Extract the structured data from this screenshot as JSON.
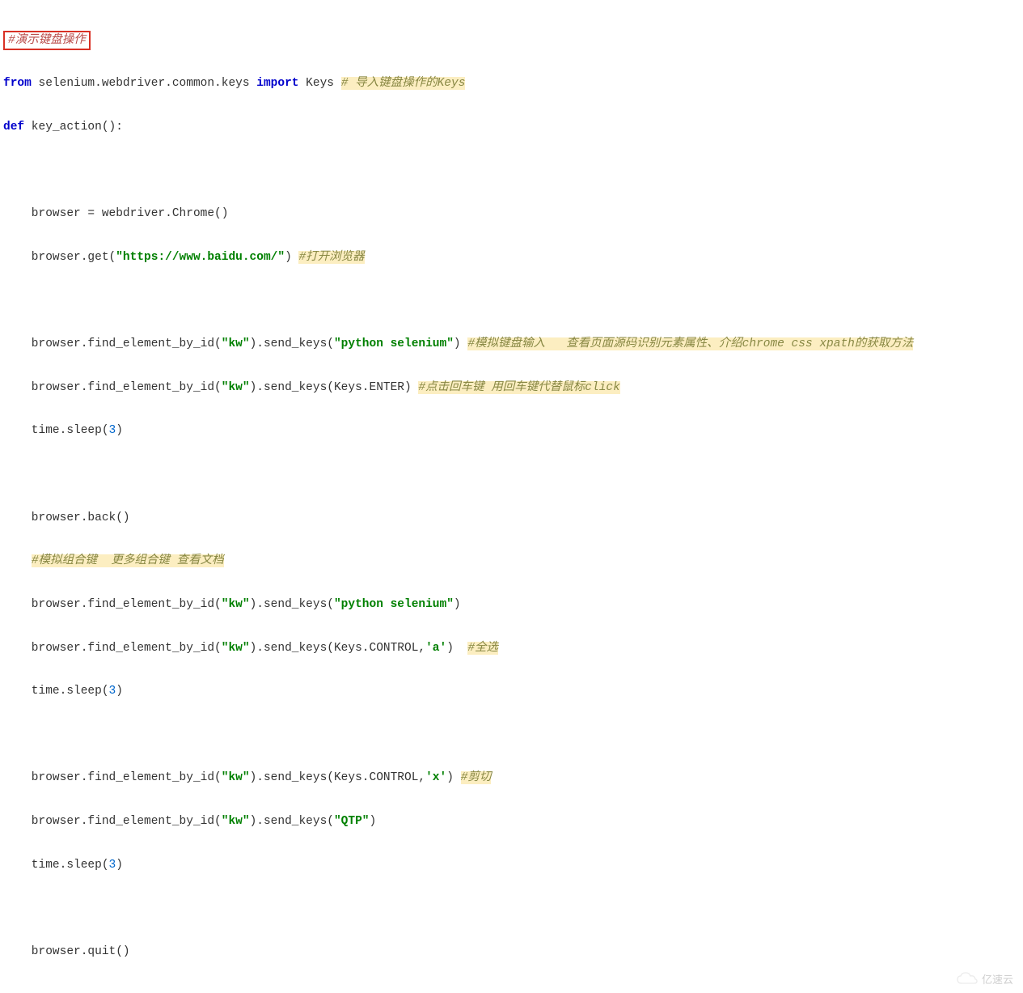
{
  "code": {
    "comment_title": "#演示键盘操作",
    "import_from": "from",
    "import_mod": " selenium.webdriver.common.keys ",
    "import_kw": "import",
    "import_name": " Keys ",
    "import_cmt": "# 导入键盘操作的Keys",
    "def_kw": "def",
    "def_name": " key_action():",
    "l_browser_assign": "    browser = webdriver.Chrome()",
    "l_get_pre": "    browser.get(",
    "l_get_url": "\"https://www.baidu.com/\"",
    "l_get_post": ") ",
    "l_get_cmt": "#打开浏览器",
    "l_send1_pre": "    browser.find_element_by_id(",
    "l_kw": "\"kw\"",
    "l_send1_mid": ").send_keys(",
    "l_send1_val": "\"python selenium\"",
    "l_send1_post": ") ",
    "l_send1_cmt": "#模拟键盘输入   查看页面源码识别元素属性、介绍chrome css xpath的获取方法",
    "l_send2_pre": "    browser.find_element_by_id(",
    "l_send2_mid": ").send_keys(Keys.ENTER) ",
    "l_send2_cmt": "#点击回车键 用回车键代替鼠标click",
    "l_sleep_pre": "    time.sleep(",
    "l_sleep_num": "3",
    "l_sleep_post": ")",
    "l_back": "    browser.back()",
    "l_combo_cmt": "#模拟组合键  更多组合键 查看文档",
    "l_send3_pre": "    browser.find_element_by_id(",
    "l_send3_mid": ").send_keys(",
    "l_send3_val": "\"python selenium\"",
    "l_send3_post": ")",
    "l_send4_pre": "    browser.find_element_by_id(",
    "l_send4_mid": ").send_keys(Keys.CONTROL,",
    "l_send4_val": "'a'",
    "l_send4_post": ")  ",
    "l_send4_cmt": "#全选",
    "l_send5_pre": "    browser.find_element_by_id(",
    "l_send5_mid": ").send_keys(Keys.CONTROL,",
    "l_send5_val": "'x'",
    "l_send5_post": ") ",
    "l_send5_cmt": "#剪切",
    "l_send6_pre": "    browser.find_element_by_id(",
    "l_send6_mid": ").send_keys(",
    "l_send6_val": "\"QTP\"",
    "l_send6_post": ")",
    "l_quit": "    browser.quit()"
  },
  "watermark": "亿速云"
}
